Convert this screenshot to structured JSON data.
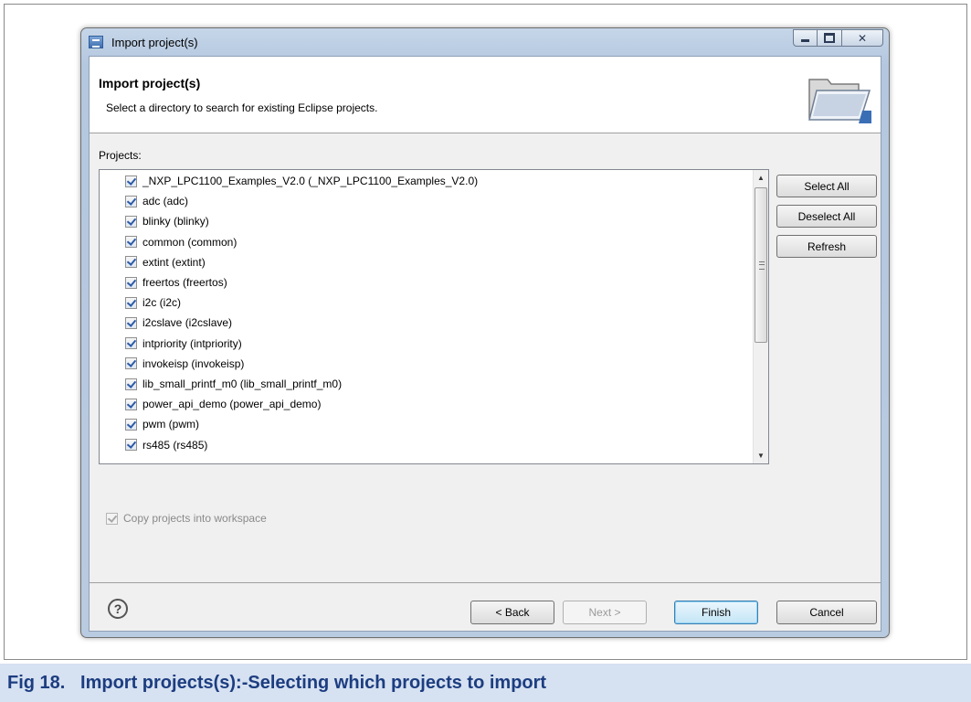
{
  "window": {
    "title": "Import project(s)"
  },
  "header": {
    "title": "Import project(s)",
    "description": "Select a directory to search for existing Eclipse projects."
  },
  "projects": {
    "label": "Projects:",
    "items": [
      {
        "label": "_NXP_LPC1100_Examples_V2.0 (_NXP_LPC1100_Examples_V2.0)",
        "checked": true
      },
      {
        "label": "adc (adc)",
        "checked": true
      },
      {
        "label": "blinky (blinky)",
        "checked": true
      },
      {
        "label": "common (common)",
        "checked": true
      },
      {
        "label": "extint (extint)",
        "checked": true
      },
      {
        "label": "freertos (freertos)",
        "checked": true
      },
      {
        "label": "i2c (i2c)",
        "checked": true
      },
      {
        "label": "i2cslave (i2cslave)",
        "checked": true
      },
      {
        "label": "intpriority (intpriority)",
        "checked": true
      },
      {
        "label": "invokeisp (invokeisp)",
        "checked": true
      },
      {
        "label": "lib_small_printf_m0 (lib_small_printf_m0)",
        "checked": true
      },
      {
        "label": "power_api_demo (power_api_demo)",
        "checked": true
      },
      {
        "label": "pwm (pwm)",
        "checked": true
      },
      {
        "label": "rs485 (rs485)",
        "checked": true
      }
    ]
  },
  "side_buttons": {
    "select_all": "Select All",
    "deselect_all": "Deselect All",
    "refresh": "Refresh"
  },
  "options": {
    "copy_into_workspace": "Copy projects into workspace",
    "copy_checked": true
  },
  "footer": {
    "back": "< Back",
    "next": "Next >",
    "finish": "Finish",
    "cancel": "Cancel",
    "help_glyph": "?"
  },
  "caption": {
    "text": "Fig 18.   Import projects(s):-Selecting which projects to import"
  },
  "colors": {
    "caption_text": "#1c3d80",
    "caption_bg": "#d6e1f1",
    "check": "#2b5aa8"
  }
}
